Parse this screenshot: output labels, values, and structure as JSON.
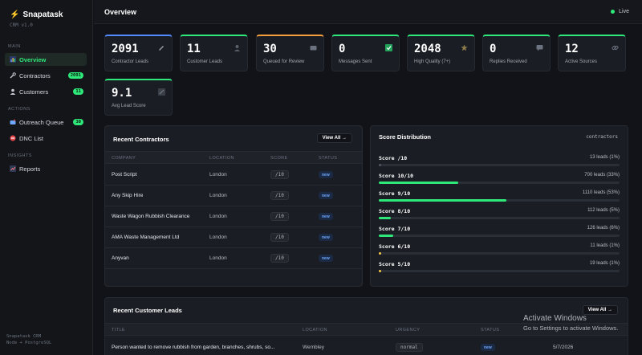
{
  "app": {
    "name": "Snapatask",
    "version": "CRM v1.0"
  },
  "sidebar": {
    "sections": [
      "MAIN",
      "ACTIONS",
      "INSIGHTS"
    ],
    "items": [
      {
        "label": "Overview",
        "icon": "chart-icon",
        "badge": ""
      },
      {
        "label": "Contractors",
        "icon": "wrench-icon",
        "badge": "2091"
      },
      {
        "label": "Customers",
        "icon": "person-icon",
        "badge": "11"
      },
      {
        "label": "Outreach Queue",
        "icon": "mailbox-icon",
        "badge": "30"
      },
      {
        "label": "DNC List",
        "icon": "no-entry-icon",
        "badge": ""
      },
      {
        "label": "Reports",
        "icon": "report-icon",
        "badge": ""
      }
    ],
    "footer": [
      "Snapatask CRM",
      "Node + PostgreSQL"
    ]
  },
  "header": {
    "title": "Overview",
    "status": "Live",
    "status_color": "#2ee879"
  },
  "stats": [
    {
      "value": "2091",
      "label": "Contractor Leads",
      "color": "#4f8bff",
      "icon": "pencil-icon"
    },
    {
      "value": "11",
      "label": "Customer Leads",
      "color": "#2ee879",
      "icon": "person-icon"
    },
    {
      "value": "30",
      "label": "Queued for Review",
      "color": "#f59e3b",
      "icon": "inbox-icon"
    },
    {
      "value": "0",
      "label": "Messages Sent",
      "color": "#2ee879",
      "icon": "check-icon"
    },
    {
      "value": "2048",
      "label": "High Quality (7+)",
      "color": "#2ee879",
      "icon": "star-icon"
    },
    {
      "value": "0",
      "label": "Replies Received",
      "color": "#2ee879",
      "icon": "chat-icon"
    },
    {
      "value": "12",
      "label": "Active Sources",
      "color": "#2ee879",
      "icon": "link-icon"
    },
    {
      "value": "9.1",
      "label": "Avg Lead Score",
      "color": "#2ee879",
      "icon": "gauge-icon"
    }
  ],
  "recent_contractors": {
    "title": "Recent Contractors",
    "view_all": "View All →",
    "columns": [
      "COMPANY",
      "LOCATION",
      "SCORE",
      "STATUS"
    ],
    "rows": [
      {
        "company": "Post Script",
        "location": "London",
        "score": "/10",
        "status": "new"
      },
      {
        "company": "Any Skip Hire",
        "location": "London",
        "score": "/10",
        "status": "new"
      },
      {
        "company": "Waste Wagon Rubbish Clearance",
        "location": "London",
        "score": "/10",
        "status": "new"
      },
      {
        "company": "AMA Waste Management Ltd",
        "location": "London",
        "score": "/10",
        "status": "new"
      },
      {
        "company": "Anyvan",
        "location": "London",
        "score": "/10",
        "status": "new"
      }
    ]
  },
  "score_distribution": {
    "title": "Score Distribution",
    "tag": "contractors",
    "rows": [
      {
        "label": "Score /10",
        "count": "13 leads (1%)",
        "pct": 1,
        "color": "#4f5662"
      },
      {
        "label": "Score 10/10",
        "count": "700 leads (33%)",
        "pct": 33,
        "color": "#2ee879"
      },
      {
        "label": "Score 9/10",
        "count": "1110 leads (53%)",
        "pct": 53,
        "color": "#2ee879"
      },
      {
        "label": "Score 8/10",
        "count": "112 leads (5%)",
        "pct": 5,
        "color": "#2ee879"
      },
      {
        "label": "Score 7/10",
        "count": "126 leads (6%)",
        "pct": 6,
        "color": "#2ee879"
      },
      {
        "label": "Score 6/10",
        "count": "11 leads (1%)",
        "pct": 1,
        "color": "#f5c542"
      },
      {
        "label": "Score 5/10",
        "count": "19 leads (1%)",
        "pct": 1,
        "color": "#f5c542"
      }
    ]
  },
  "recent_customers": {
    "title": "Recent Customer Leads",
    "view_all": "View All →",
    "columns": [
      "TITLE",
      "LOCATION",
      "URGENCY",
      "STATUS"
    ],
    "rows": [
      {
        "title": "Person wanted to remove rubbish from garden, branches, shrubs, so...",
        "location": "Wembley",
        "urgency": "normal",
        "status": "new",
        "date": "5/7/2026"
      }
    ]
  },
  "watermark": {
    "line1": "Activate Windows",
    "line2": "Go to Settings to activate Windows."
  }
}
